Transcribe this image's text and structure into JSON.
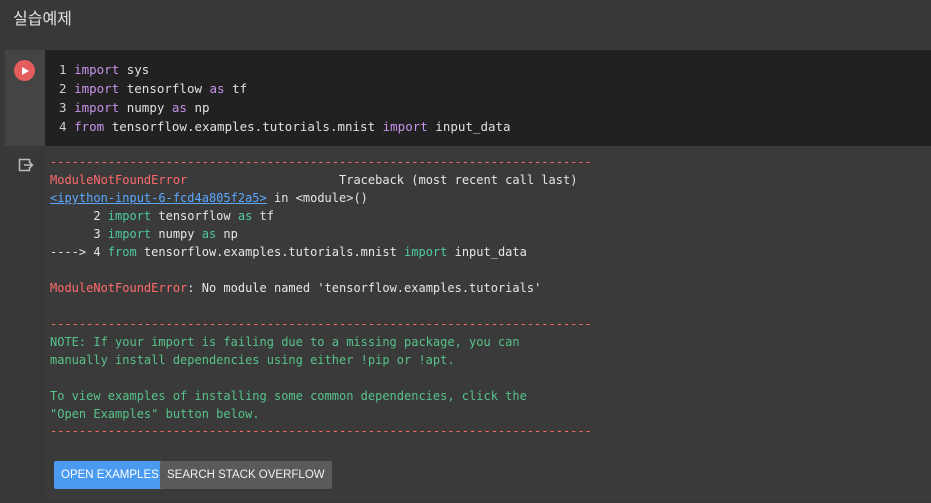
{
  "section": {
    "title": "실습예제"
  },
  "code": {
    "lines": [
      {
        "num": "1",
        "kw1": "import",
        "rest1": " sys",
        "kw2": "",
        "rest2": ""
      },
      {
        "num": "2",
        "kw1": "import",
        "rest1": " tensorflow ",
        "kw2": "as",
        "rest2": " tf"
      },
      {
        "num": "3",
        "kw1": "import",
        "rest1": " numpy ",
        "kw2": "as",
        "rest2": " np"
      },
      {
        "num": "4",
        "kw1": "from",
        "rest1": " tensorflow.examples.tutorials.mnist ",
        "kw2": "import",
        "rest2": " input_data"
      }
    ]
  },
  "output": {
    "separator": "---------------------------------------------------------------------------",
    "error_name": "ModuleNotFoundError",
    "traceback_label": "Traceback (most recent call last)",
    "input_link": "<ipython-input-6-fcd4a805f2a5>",
    "in_module": " in <module>()",
    "tb_lines": [
      {
        "prefix": "      2 ",
        "kw1": "import",
        "mid": " tensorflow ",
        "kw2": "as",
        "end": " tf"
      },
      {
        "prefix": "      3 ",
        "kw1": "import",
        "mid": " numpy ",
        "kw2": "as",
        "end": " np"
      },
      {
        "prefix": "----> 4 ",
        "kw1": "from",
        "mid": " tensorflow.examples.tutorials.mnist ",
        "kw2": "import",
        "end": " input_data"
      }
    ],
    "error_message": ": No module named 'tensorflow.examples.tutorials'",
    "note_line1": "NOTE: If your import is failing due to a missing package, you can",
    "note_line2": "manually install dependencies using either !pip or !apt.",
    "note_line3": "To view examples of installing some common dependencies, click the",
    "note_line4": "\"Open Examples\" button below."
  },
  "buttons": {
    "open_examples": "OPEN EXAMPLES",
    "search_stack_overflow": "SEARCH STACK OVERFLOW"
  },
  "colors": {
    "editor_bg": "#212121",
    "error": "#ff6b6b",
    "keyword": "#c792ea",
    "note": "#57c28a",
    "link": "#5aa9ff",
    "run_button": "#e35d5d",
    "primary_button": "#4a9bf0"
  },
  "icons": {
    "run": "play-icon",
    "output": "output-exit-icon"
  }
}
